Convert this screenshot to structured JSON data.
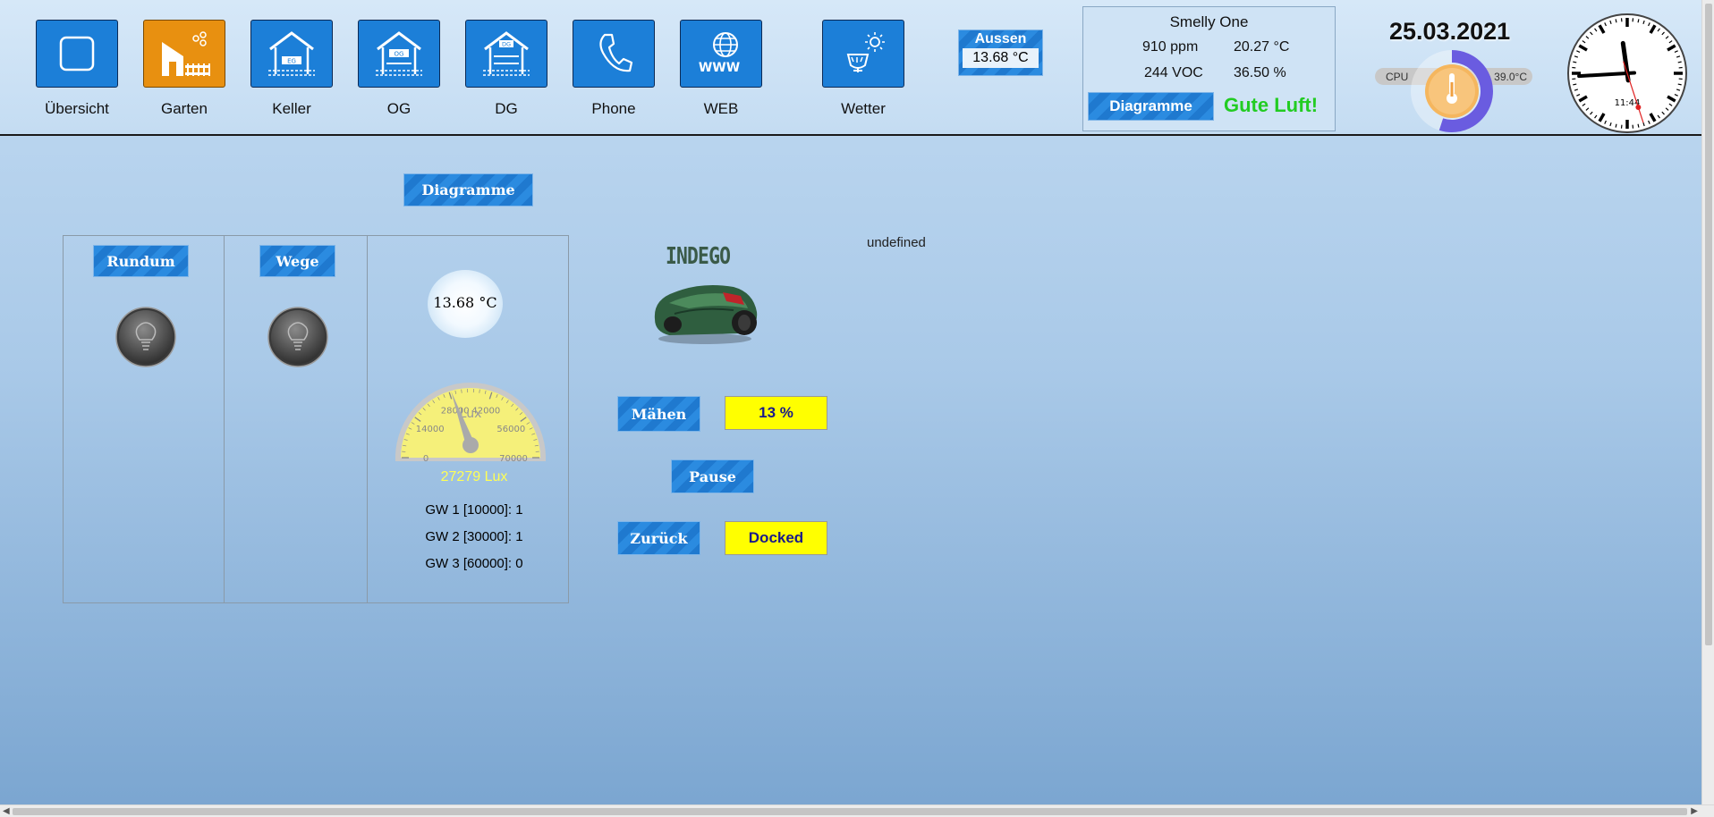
{
  "nav": [
    {
      "label": "Übersicht",
      "icon": "square-icon"
    },
    {
      "label": "Garten",
      "icon": "garden-icon"
    },
    {
      "label": "Keller",
      "icon": "basement-house-icon",
      "tag": "EG"
    },
    {
      "label": "OG",
      "icon": "upper-floor-house-icon",
      "tag": "OG"
    },
    {
      "label": "DG",
      "icon": "attic-house-icon",
      "tag": "DG"
    },
    {
      "label": "Phone",
      "icon": "phone-icon"
    },
    {
      "label": "WEB",
      "icon": "globe-www-icon",
      "tag": "WWW"
    },
    {
      "label": "Wetter",
      "icon": "weather-icon"
    }
  ],
  "aussen": {
    "title": "Aussen",
    "value": "13.68 °C"
  },
  "smelly": {
    "title": "Smelly One",
    "ppm": "910 ppm",
    "temp": "20.27 °C",
    "voc": "244 VOC",
    "humidity": "36.50 %",
    "button": "Diagramme",
    "status": "Gute Luft!"
  },
  "date": "25.03.2021",
  "cpu": {
    "label": "CPU",
    "temp": "39.0°C",
    "level": 0.55
  },
  "clock": {
    "time": "11:44",
    "hour": 11,
    "minute": 44,
    "second": 27
  },
  "main": {
    "diagram_button": "Diagramme",
    "rundum": "Rundum",
    "wege": "Wege",
    "temperature": "13.68 °C",
    "lux": {
      "unit": "Lux",
      "value": 27279,
      "value_text": "27279 Lux",
      "ticks": [
        "0",
        "14000",
        "28000",
        "42000",
        "56000",
        "70000"
      ],
      "max": 70000
    },
    "gw": [
      "GW 1 [10000]: 1",
      "GW 2 [30000]: 1",
      "GW 3 [60000]: 0"
    ],
    "indego": "INDEGO",
    "undefined_text": "undefined",
    "mow_button": "Mähen",
    "mow_value": "13 %",
    "pause_button": "Pause",
    "back_button": "Zurück",
    "back_value": "Docked"
  },
  "colors": {
    "accent": "#1c7fd8",
    "active": "#e89010",
    "status_yellow": "#ffff00",
    "good": "#22cc22"
  }
}
